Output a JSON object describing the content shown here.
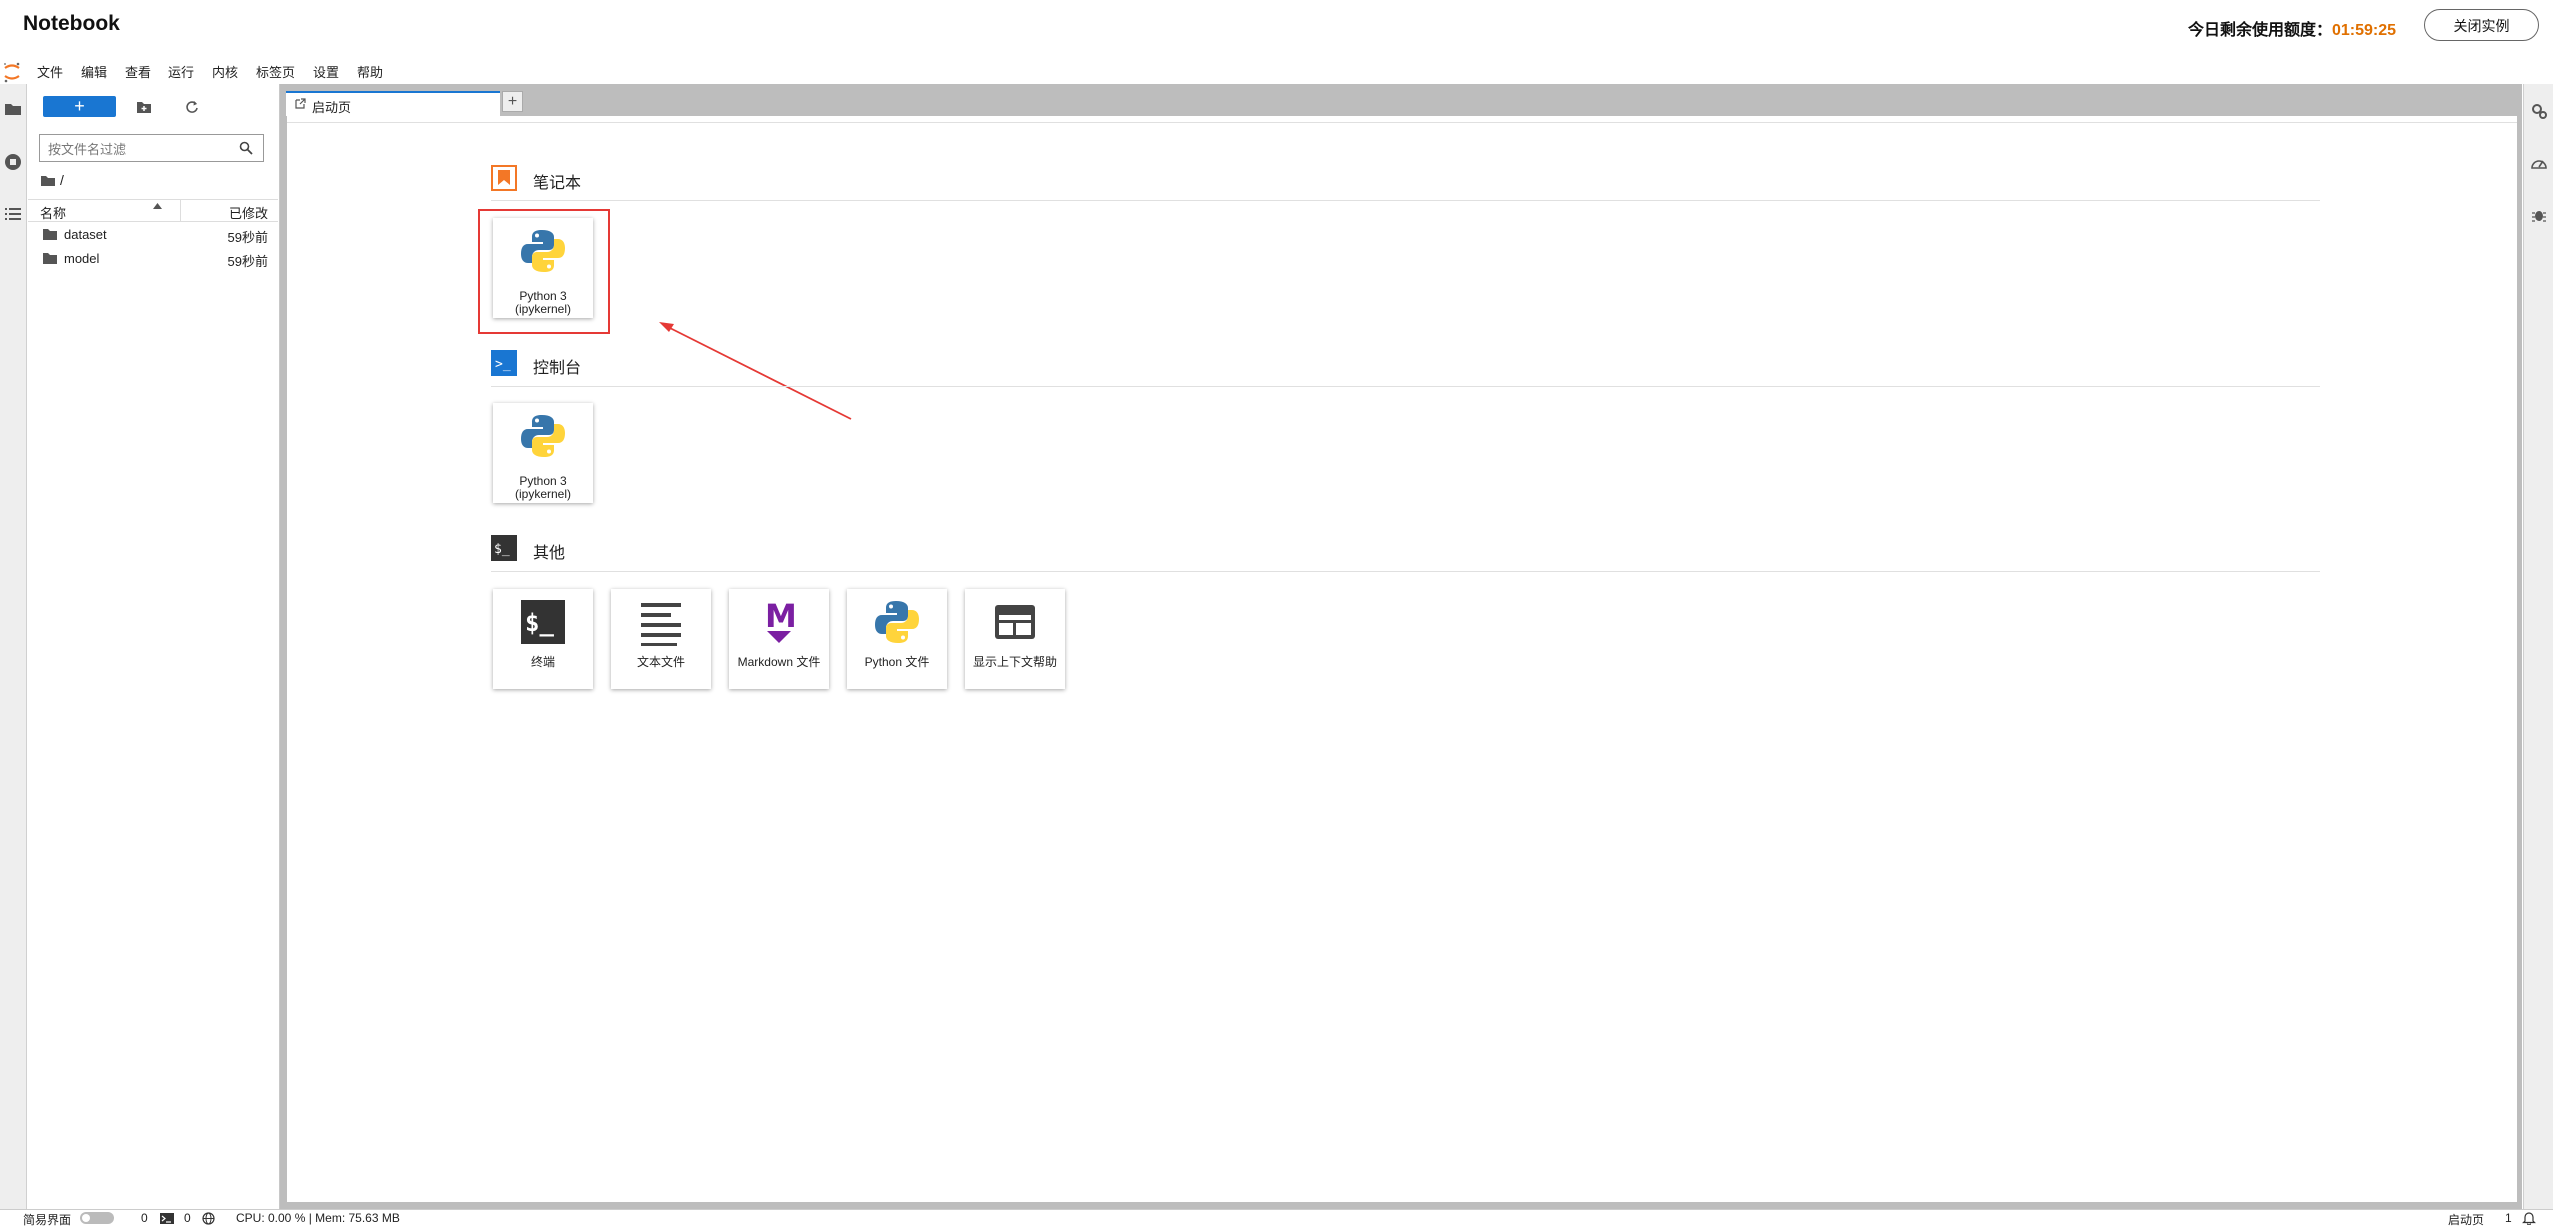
{
  "app": {
    "title": "Notebook",
    "quota_label": "今日剩余使用额度：",
    "quota_time": "01:59:25",
    "close_button": "关闭实例"
  },
  "menu": [
    "文件",
    "编辑",
    "查看",
    "运行",
    "内核",
    "标签页",
    "设置",
    "帮助"
  ],
  "filebrowser": {
    "new_button": "+",
    "filter_placeholder": "按文件名过滤",
    "breadcrumb": "/",
    "col_name": "名称",
    "col_modified": "已修改",
    "files": [
      {
        "name": "dataset",
        "modified": "59秒前"
      },
      {
        "name": "model",
        "modified": "59秒前"
      }
    ]
  },
  "tabs": {
    "launcher_label": "启动页",
    "add_label": "+"
  },
  "launcher": {
    "notebook_section": "笔记本",
    "console_section": "控制台",
    "other_section": "其他",
    "notebook_card": {
      "line1": "Python 3",
      "line2": "(ipykernel)"
    },
    "console_card": {
      "line1": "Python 3",
      "line2": "(ipykernel)"
    },
    "other_cards": [
      "终端",
      "文本文件",
      "Markdown 文件",
      "Python 文件",
      "显示上下文帮助"
    ],
    "terminal_icon_text": "$_",
    "console_icon_text": ">_",
    "markdown_icon_text": "M"
  },
  "statusbar": {
    "simple_label": "简易界面",
    "kernels_count": "0",
    "terminals_count": "0",
    "resources": "CPU: 0.00 % | Mem: 75.63 MB",
    "active_tab": "启动页",
    "notifications": "1"
  },
  "colors": {
    "accent": "#1976d2",
    "notebook_icon": "#f37726",
    "highlight": "#e53935",
    "quota_time": "#e07000",
    "markdown": "#7b1fa2"
  }
}
